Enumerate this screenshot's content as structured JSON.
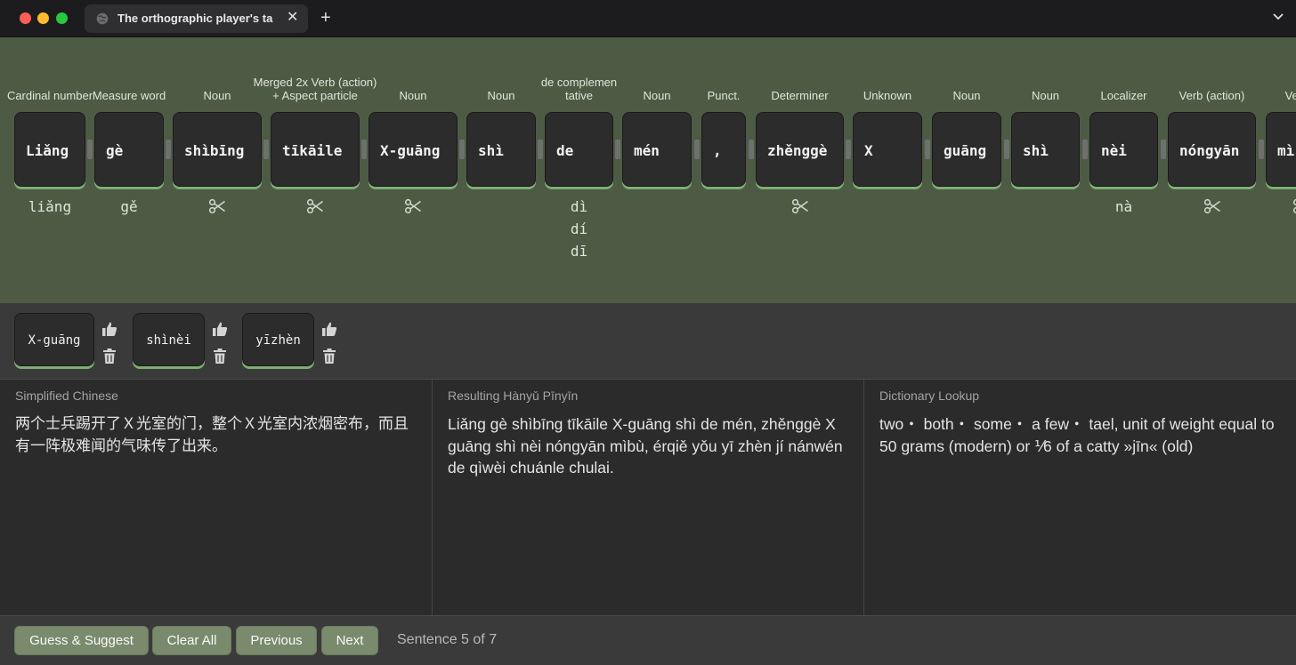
{
  "window": {
    "tab_title": "The orthographic player's table",
    "tab_close": "✕",
    "new_tab": "+"
  },
  "tokens": [
    {
      "pos": "Cardinal number",
      "text": "Liǎng",
      "alts": [
        "liǎng"
      ],
      "scissor": false
    },
    {
      "pos": "Measure word",
      "text": "gè",
      "alts": [
        "gě"
      ],
      "scissor": false
    },
    {
      "pos": "Noun",
      "text": "shìbīng",
      "alts": [],
      "scissor": true
    },
    {
      "pos": "Merged 2x Verb (action) + Aspect particle",
      "text": "tīkāile",
      "alts": [],
      "scissor": true
    },
    {
      "pos": "Noun",
      "text": "X-guāng",
      "alts": [],
      "scissor": true
    },
    {
      "pos": "Noun",
      "text": "shì",
      "alts": [],
      "scissor": false
    },
    {
      "pos": "de complemen tative",
      "text": "de",
      "alts": [
        "dì",
        "dí",
        "dī"
      ],
      "scissor": false
    },
    {
      "pos": "Noun",
      "text": "mén",
      "alts": [],
      "scissor": false
    },
    {
      "pos": "Punct.",
      "text": ",",
      "alts": [],
      "scissor": false
    },
    {
      "pos": "Determiner",
      "text": "zhěnggè",
      "alts": [],
      "scissor": true
    },
    {
      "pos": "Unknown",
      "text": "X",
      "alts": [],
      "scissor": false
    },
    {
      "pos": "Noun",
      "text": "guāng",
      "alts": [],
      "scissor": false
    },
    {
      "pos": "Noun",
      "text": "shì",
      "alts": [],
      "scissor": false
    },
    {
      "pos": "Localizer",
      "text": "nèi",
      "alts": [
        "nà"
      ],
      "scissor": false
    },
    {
      "pos": "Verb (action)",
      "text": "nóngyān",
      "alts": [],
      "scissor": true
    },
    {
      "pos": "Ve (ac",
      "text": "mì",
      "alts": [],
      "scissor": true
    }
  ],
  "suggestions": [
    {
      "text": "X-guāng"
    },
    {
      "text": "shìnèi"
    },
    {
      "text": "yīzhèn"
    }
  ],
  "panes": {
    "chinese": {
      "label": "Simplified Chinese",
      "text": "两个士兵踢开了Ｘ光室的门，整个Ｘ光室内浓烟密布，而且有一阵极难闻的气味传了出来。"
    },
    "pinyin": {
      "label": "Resulting Hànyǔ Pīnyīn",
      "text": "Liǎng gè shìbīng tīkāile X-guāng shì de mén, zhěnggè X guāng shì nèi nóngyān mìbù, érqiě yǒu yī zhèn jí nánwén de qìwèi chuánle chulai."
    },
    "dictionary": {
      "label": "Dictionary Lookup",
      "text": "two・ both・ some・ a few・ tael, unit of weight equal to 50 grams (modern) or ⅟6 of a catty »jīn« (old)"
    }
  },
  "bottom": {
    "guess_label": "Guess & Suggest",
    "clear_label": "Clear All",
    "previous_label": "Previous",
    "next_label": "Next",
    "sentence_status": "Sentence 5 of 7"
  },
  "colors": {
    "token_area_bg": "#4d5b45",
    "card_accent": "#7fae74",
    "button_bg": "#7a8a6d"
  },
  "icons": {
    "scissor": "scissors-icon",
    "thumb": "thumbs-up-icon",
    "trash": "trash-icon"
  }
}
